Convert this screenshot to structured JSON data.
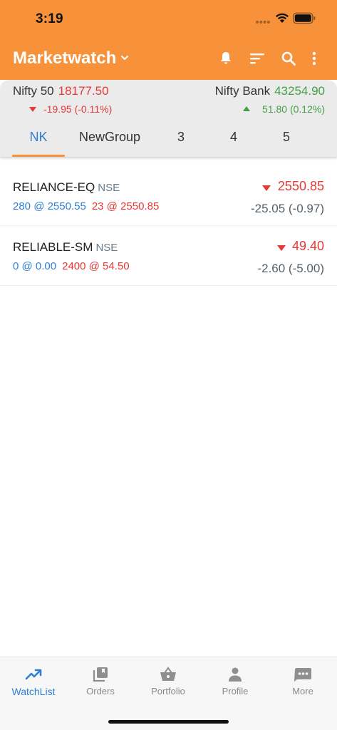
{
  "status_bar": {
    "time": "3:19"
  },
  "app_bar": {
    "title": "Marketwatch",
    "icons": [
      "chevron-down-icon",
      "bell-icon",
      "sort-icon",
      "search-icon",
      "more-vert-icon"
    ]
  },
  "indices": {
    "left": {
      "name": "Nifty 50",
      "value": "18177.50",
      "change": "-19.95 (-0.11%)",
      "direction": "down"
    },
    "right": {
      "name": "Nifty Bank",
      "value": "43254.90",
      "change": "51.80 (0.12%)",
      "direction": "up"
    }
  },
  "tabs": [
    {
      "label": "NK",
      "active": true
    },
    {
      "label": "NewGroup",
      "active": false
    },
    {
      "label": "3",
      "active": false
    },
    {
      "label": "4",
      "active": false
    },
    {
      "label": "5",
      "active": false
    }
  ],
  "watchlist": [
    {
      "symbol": "RELIANCE-EQ",
      "exchange": "NSE",
      "bid": "280 @ 2550.55",
      "ask": "23 @ 2550.85",
      "ltp": "2550.85",
      "change": "-25.05 (-0.97)",
      "direction": "down"
    },
    {
      "symbol": "RELIABLE-SM",
      "exchange": "NSE",
      "bid": "0 @ 0.00",
      "ask": "2400 @ 54.50",
      "ltp": "49.40",
      "change": "-2.60 (-5.00)",
      "direction": "down"
    }
  ],
  "bottom_nav": [
    {
      "label": "WatchList",
      "icon": "trending-up-icon",
      "active": true
    },
    {
      "label": "Orders",
      "icon": "orders-icon",
      "active": false
    },
    {
      "label": "Portfolio",
      "icon": "basket-icon",
      "active": false
    },
    {
      "label": "Profile",
      "icon": "person-icon",
      "active": false
    },
    {
      "label": "More",
      "icon": "more-chat-icon",
      "active": false
    }
  ],
  "colors": {
    "brand": "#f7923a",
    "accent": "#2f80d1",
    "negative": "#e53935",
    "positive": "#43a047"
  }
}
